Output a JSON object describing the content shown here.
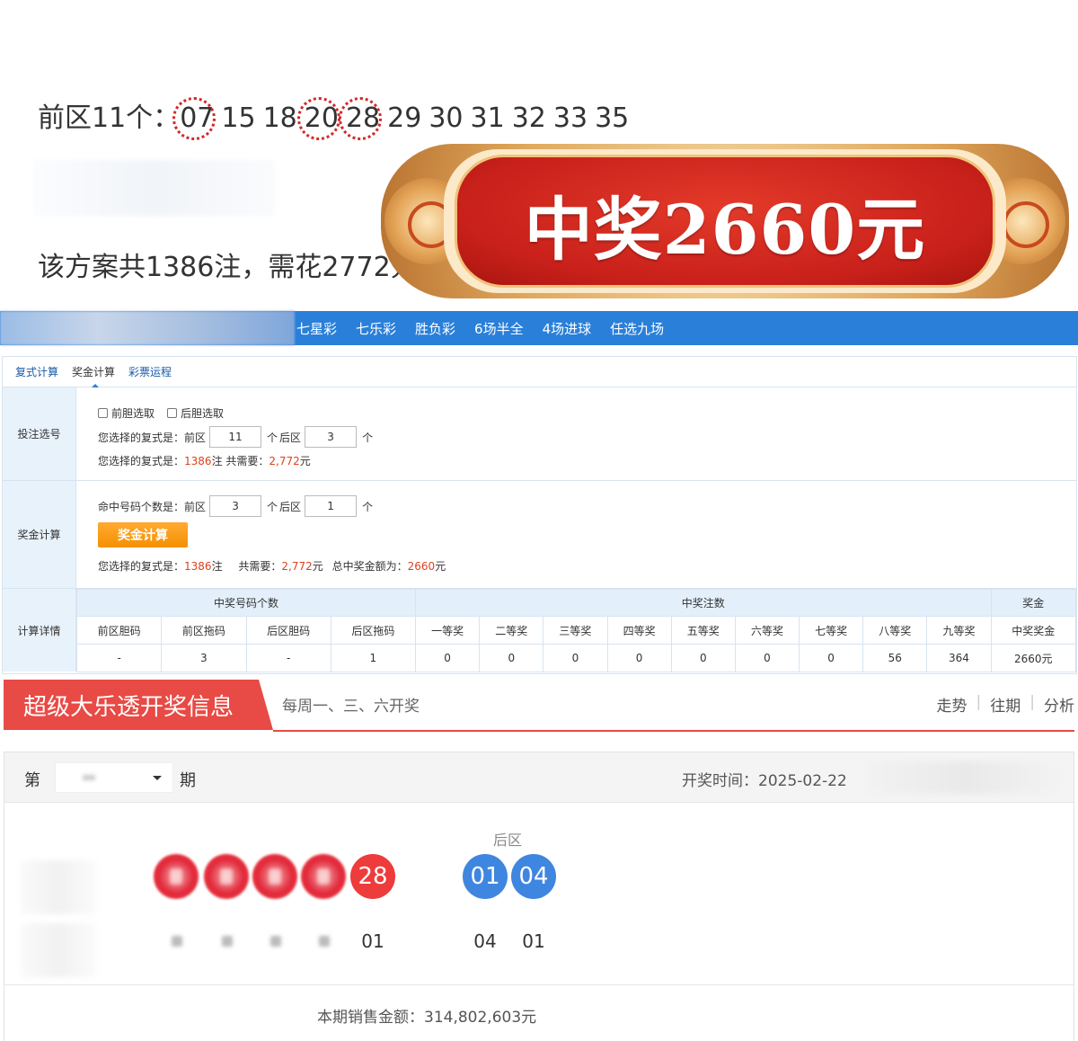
{
  "promo": {
    "front_label": "前区11个：",
    "front_numbers": [
      {
        "n": "07",
        "circled": true
      },
      {
        "n": "15",
        "circled": false
      },
      {
        "n": "18",
        "circled": false
      },
      {
        "n": "20",
        "circled": true
      },
      {
        "n": "28",
        "circled": true
      },
      {
        "n": "29",
        "circled": false
      },
      {
        "n": "30",
        "circled": false
      },
      {
        "n": "31",
        "circled": false
      },
      {
        "n": "32",
        "circled": false
      },
      {
        "n": "33",
        "circled": false
      },
      {
        "n": "35",
        "circled": false
      }
    ],
    "cost_text": "该方案共1386注，需花2772元",
    "banner_text": "中奖2660元"
  },
  "nav": {
    "items": [
      "七星彩",
      "七乐彩",
      "胜负彩",
      "6场半全",
      "4场进球",
      "任选九场"
    ]
  },
  "calc": {
    "tabs": [
      "复式计算",
      "奖金计算",
      "彩票运程"
    ],
    "active_tab": 1,
    "bet": {
      "label": "投注选号",
      "front_dan": "前胆选取",
      "back_dan": "后胆选取",
      "choose_prefix": "您选择的复式是：",
      "front_label": "前区",
      "front_value": "11",
      "unit": "个",
      "back_label": "后区",
      "back_value": "3",
      "summary_prefix": "您选择的复式是：",
      "summary_count": "1386",
      "summary_mid": "注 共需要：",
      "summary_cost": "2,772",
      "summary_unit": "元"
    },
    "prize": {
      "label": "奖金计算",
      "hit_prefix": "命中号码个数是：",
      "front_label": "前区",
      "front_value": "3",
      "unit": "个",
      "back_label": "后区",
      "back_value": "1",
      "button": "奖金计算",
      "summary_prefix": "您选择的复式是：",
      "summary_count": "1386",
      "summary_mid1": "注",
      "summary_need": "共需要：",
      "summary_cost": "2,772",
      "summary_unit": "元",
      "summary_total_label": "总中奖金额为：",
      "summary_total": "2660",
      "summary_total_unit": "元"
    },
    "detail": {
      "label": "计算详情",
      "group_headers": [
        "中奖号码个数",
        "中奖注数",
        "奖金"
      ],
      "columns": [
        "前区胆码",
        "前区拖码",
        "后区胆码",
        "后区拖码",
        "一等奖",
        "二等奖",
        "三等奖",
        "四等奖",
        "五等奖",
        "六等奖",
        "七等奖",
        "八等奖",
        "九等奖",
        "中奖奖金"
      ],
      "values": [
        "-",
        "3",
        "-",
        "1",
        "0",
        "0",
        "0",
        "0",
        "0",
        "0",
        "0",
        "56",
        "364",
        "2660元"
      ]
    }
  },
  "draw": {
    "title": "超级大乐透开奖信息",
    "schedule": "每周一、三、六开奖",
    "links": [
      "走势",
      "往期",
      "分析"
    ],
    "issue_prefix": "第",
    "issue_suffix": "期",
    "date_text": "开奖时间：2025-02-22",
    "back_label": "后区",
    "front_visible_ball": "28",
    "back_balls": [
      "01",
      "04"
    ],
    "front_visible_count": "01",
    "back_counts": [
      "04",
      "01"
    ],
    "sales_label": "本期销售金额：",
    "sales_value": "314,802,603元"
  }
}
